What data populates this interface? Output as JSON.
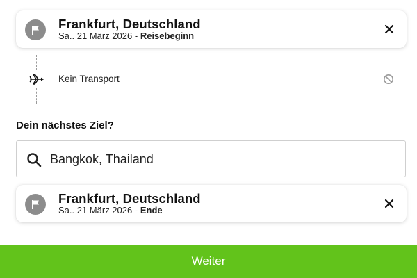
{
  "origin": {
    "title": "Frankfurt, Deutschland",
    "date": "Sa.. 21 März 2026",
    "separator": "-",
    "suffix": "Reisebeginn",
    "icon": "flag-icon"
  },
  "transport": {
    "label": "Kein Transport",
    "icon": "plane-icon",
    "status_icon": "disabled-circle-icon"
  },
  "next_destination": {
    "heading": "Dein nächstes Ziel?",
    "input_value": "Bangkok, Thailand",
    "icon": "search-icon"
  },
  "end": {
    "title": "Frankfurt, Deutschland",
    "date": "Sa.. 21 März 2026",
    "separator": "-",
    "suffix": "Ende",
    "icon": "flag-icon"
  },
  "footer": {
    "continue_label": "Weiter"
  },
  "colors": {
    "accent": "#62c31b",
    "flag_circle": "#8c8c8c"
  }
}
